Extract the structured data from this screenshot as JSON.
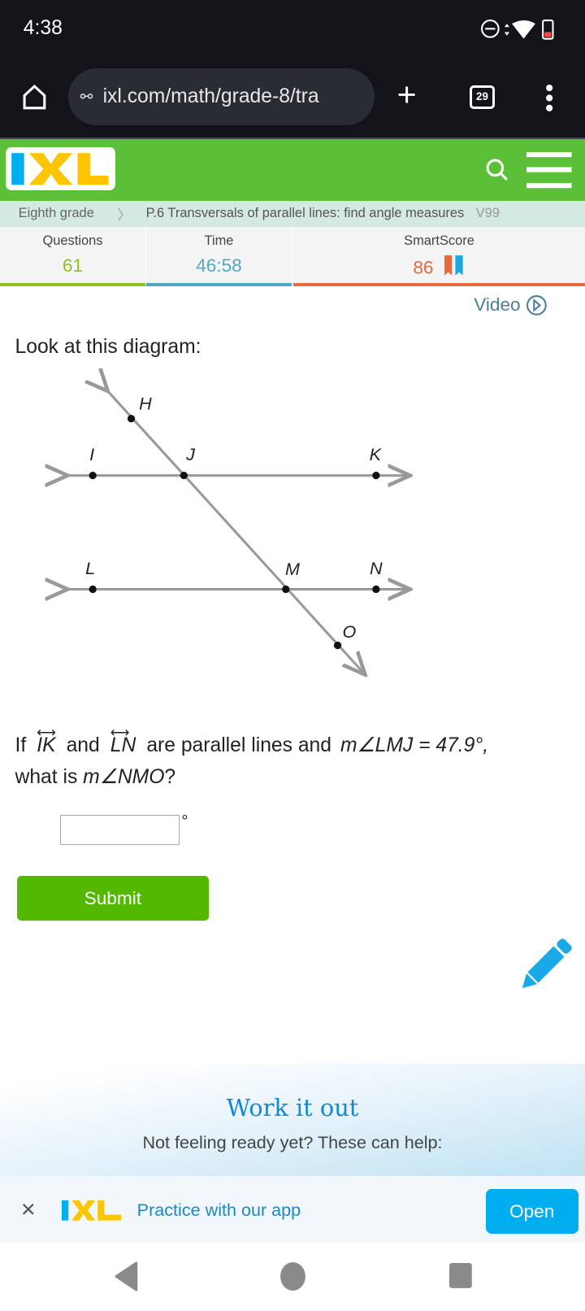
{
  "status_bar": {
    "time": "4:38"
  },
  "browser": {
    "url": "ixl.com/math/grade-8/tra",
    "tab_count": "29"
  },
  "breadcrumb": {
    "grade": "Eighth grade",
    "skill": "P.6 Transversals of parallel lines: find angle measures",
    "code": "V99"
  },
  "stats": {
    "questions_label": "Questions",
    "questions_value": "61",
    "time_label": "Time",
    "time_value": "46:58",
    "smartscore_label": "SmartScore",
    "smartscore_value": "86"
  },
  "colors": {
    "header_green": "#5bbf38",
    "questions": "#8dc21f",
    "time": "#4fa8c8",
    "smartscore": "#e8693a",
    "submit": "#52b800",
    "open": "#00aeef"
  },
  "video_label": "Video",
  "question": {
    "intro": "Look at this diagram:",
    "if": "If",
    "line1": "IK",
    "and": "and",
    "line2": "LN",
    "rest": "are parallel lines and",
    "measure_given": "m∠LMJ = 47.9°,",
    "ask_prefix": "what is",
    "ask_angle": "m∠NMO",
    "ask_suffix": "?",
    "degree": "°",
    "answer_value": ""
  },
  "diagram": {
    "points": [
      "H",
      "I",
      "J",
      "K",
      "L",
      "M",
      "N",
      "O"
    ]
  },
  "submit_label": "Submit",
  "work_it_out": {
    "title": "Work it out",
    "subtitle": "Not feeling ready yet? These can help:"
  },
  "app_banner": {
    "text": "Practice with our app",
    "open_label": "Open"
  }
}
